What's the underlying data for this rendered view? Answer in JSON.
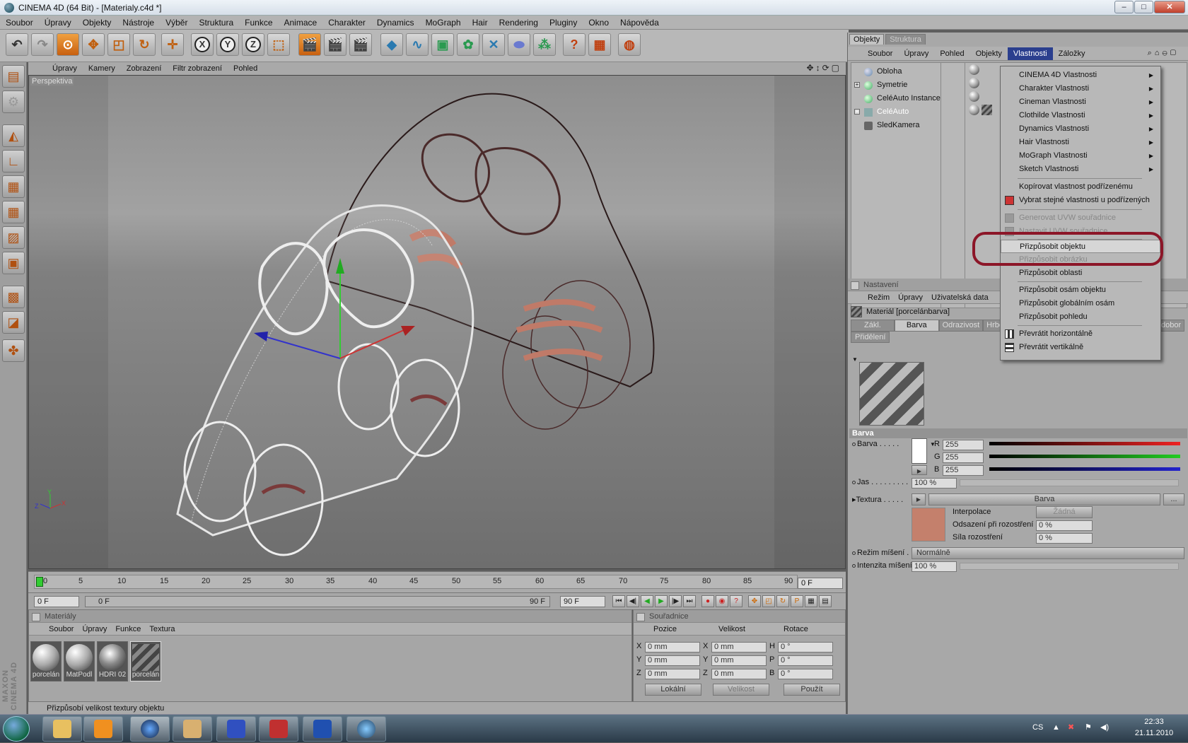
{
  "window": {
    "title": "CINEMA 4D (64 Bit) - [Materialy.c4d *]"
  },
  "menubar": [
    "Soubor",
    "Úpravy",
    "Objekty",
    "Nástroje",
    "Výběr",
    "Struktura",
    "Funkce",
    "Animace",
    "Charakter",
    "Dynamics",
    "MoGraph",
    "Hair",
    "Rendering",
    "Pluginy",
    "Okno",
    "Nápověda"
  ],
  "viewport": {
    "menu": [
      "Úpravy",
      "Kamery",
      "Zobrazení",
      "Filtr zobrazení",
      "Pohled"
    ],
    "label": "Perspektiva",
    "axis_y": "Y",
    "axis_z": "Z",
    "axis_x": "X"
  },
  "timeline": {
    "ticks": [
      "0",
      "5",
      "10",
      "15",
      "20",
      "25",
      "30",
      "35",
      "40",
      "45",
      "50",
      "55",
      "60",
      "65",
      "70",
      "75",
      "80",
      "85",
      "90"
    ],
    "current_frame": "0 F",
    "start_field": "0 F",
    "range_start": "0 F",
    "range_end": "90 F",
    "end_field": "90 F"
  },
  "materials": {
    "title": "Materiály",
    "menu": [
      "Soubor",
      "Úpravy",
      "Funkce",
      "Textura"
    ],
    "items": [
      "porcelán",
      "MatPodl",
      "HDRI 02",
      "porcelán"
    ]
  },
  "coords": {
    "title": "Souřadnice",
    "col_pos": "Pozice",
    "col_size": "Velikost",
    "col_rot": "Rotace",
    "rows": [
      {
        "a": "X",
        "pos": "0 mm",
        "b": "X",
        "size": "0 mm",
        "c": "H",
        "rot": "0 °"
      },
      {
        "a": "Y",
        "pos": "0 mm",
        "b": "Y",
        "size": "0 mm",
        "c": "P",
        "rot": "0 °"
      },
      {
        "a": "Z",
        "pos": "0 mm",
        "b": "Z",
        "size": "0 mm",
        "c": "B",
        "rot": "0 °"
      }
    ],
    "mode": "Lokální",
    "size_mode": "Velikost",
    "apply": "Použít"
  },
  "status": "Přizpůsobí velikost textury objektu",
  "objects": {
    "tabs": [
      "Objekty",
      "Struktura"
    ],
    "menu": [
      "Soubor",
      "Úpravy",
      "Pohled",
      "Objekty",
      "Vlastnosti",
      "Záložky"
    ],
    "active_menu": "Vlastnosti",
    "list": [
      "Obloha",
      "Symetrie",
      "CeléAuto Instance",
      "CeléAuto",
      "SledKamera"
    ]
  },
  "attributes": {
    "section": "Nastavení",
    "menu": [
      "Režim",
      "Úpravy",
      "Uživatelská data"
    ],
    "material_name": "Materiál [porcelánbarva]",
    "tabs": [
      "Zákl.",
      "Barva",
      "Odrazivost",
      "Hrbolat",
      "Pdobor"
    ],
    "active_tab": "Barva",
    "tab2": "Přidělení",
    "group": "Barva",
    "color_label": "Barva . . . . .",
    "r_label": "R",
    "r": "255",
    "g_label": "G",
    "g": "255",
    "b_label": "B",
    "b": "255",
    "jas_label": "Jas . . . . . . . . .",
    "jas": "100 %",
    "texture_label": "Textura . . . . .",
    "texture_btn": "Barva",
    "more_btn": "...",
    "interp_label": "Interpolace",
    "interp": "Žádná",
    "blur_off_label": "Odsazení při rozostření",
    "blur_off": "0 %",
    "blur_str_label": "Síla rozostření",
    "blur_str": "0 %",
    "mix_mode_label": "Režim míšení . .",
    "mix_mode": "Normálně",
    "mix_int_label": "Intenzita míšení",
    "mix_int": "100 %"
  },
  "context_menu": {
    "submenus": [
      "CINEMA 4D Vlastnosti",
      "Charakter Vlastnosti",
      "Cineman Vlastnosti",
      "Clothilde Vlastnosti",
      "Dynamics Vlastnosti",
      "Hair Vlastnosti",
      "MoGraph Vlastnosti",
      "Sketch Vlastnosti"
    ],
    "copy": "Kopírovat vlastnost podřízenému",
    "select_same": "Vybrat stejné vlastnosti u podřízených",
    "gen_uvw": "Generovat UVW souřadnice",
    "set_uvw": "Nastavit UVW souřadnice",
    "fit_object": "Přizpůsobit objektu",
    "fit_image": "Přizpůsobit obrázku",
    "fit_area": "Přizpůsobit oblasti",
    "fit_axes": "Přizpůsobit osám objektu",
    "fit_global": "Přizpůsobit globálním osám",
    "fit_view": "Přizpůsobit pohledu",
    "flip_h": "Převrátit horizontálně",
    "flip_v": "Převrátit vertikálně",
    "highlighted": "Přizpůsobit objektu"
  },
  "taskbar": {
    "lang": "CS",
    "time": "22:33",
    "date": "21.11.2010"
  },
  "colors": {
    "accent_menu": "#2b3f8e",
    "highlight_ring": "#8c1628",
    "texture_swatch": "#c4806c"
  }
}
